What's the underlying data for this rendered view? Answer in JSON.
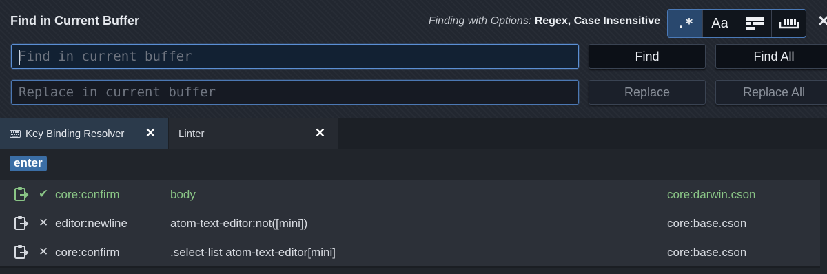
{
  "find_panel": {
    "title": "Find in Current Buffer",
    "options_label": "Finding with Options:",
    "options_value": "Regex, Case Insensitive",
    "option_buttons": [
      {
        "name": "regex",
        "glyph": ".*",
        "selected": true
      },
      {
        "name": "case-sensitive",
        "glyph": "Aa",
        "selected": false
      },
      {
        "name": "in-selection",
        "icon": "selection-icon",
        "selected": false
      },
      {
        "name": "whole-word",
        "icon": "whole-word-icon",
        "selected": false
      }
    ],
    "close_glyph": "✕",
    "find_placeholder": "Find in current buffer",
    "replace_placeholder": "Replace in current buffer",
    "find_label": "Find",
    "find_all_label": "Find All",
    "replace_label": "Replace",
    "replace_all_label": "Replace All"
  },
  "tabs": [
    {
      "label": "Key Binding Resolver",
      "icon": "keyboard-icon",
      "active": true,
      "close": "✕"
    },
    {
      "label": "Linter",
      "active": false,
      "close": "✕"
    }
  ],
  "resolver": {
    "keystroke": "enter",
    "rows": [
      {
        "status": "matched",
        "mark": "✔",
        "command": "core:confirm",
        "selector": "body",
        "source": "core:darwin.cson"
      },
      {
        "status": "unmatched",
        "mark": "✕",
        "command": "editor:newline",
        "selector": "atom-text-editor:not([mini])",
        "source": "core:base.cson"
      },
      {
        "status": "unmatched",
        "mark": "✕",
        "command": "core:confirm",
        "selector": ".select-list atom-text-editor[mini]",
        "source": "core:base.cson"
      }
    ]
  },
  "colors": {
    "accent": "#4c78b3",
    "matched": "#8ac586",
    "panel_bg": "#222730",
    "keystroke_bg": "#3b6ea5"
  }
}
